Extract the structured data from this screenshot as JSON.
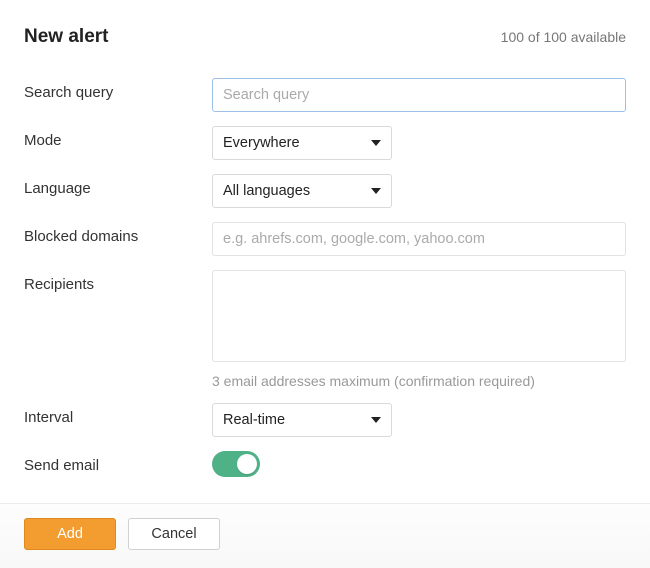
{
  "header": {
    "title": "New alert",
    "available_text": "100 of 100 available"
  },
  "fields": {
    "search_query": {
      "label": "Search query",
      "placeholder": "Search query",
      "value": ""
    },
    "mode": {
      "label": "Mode",
      "selected": "Everywhere"
    },
    "language": {
      "label": "Language",
      "selected": "All languages"
    },
    "blocked_domains": {
      "label": "Blocked domains",
      "placeholder": "e.g. ahrefs.com, google.com, yahoo.com",
      "value": ""
    },
    "recipients": {
      "label": "Recipients",
      "value": "",
      "hint": "3 email addresses maximum (confirmation required)"
    },
    "interval": {
      "label": "Interval",
      "selected": "Real-time"
    },
    "send_email": {
      "label": "Send email",
      "enabled": true
    }
  },
  "footer": {
    "add_label": "Add",
    "cancel_label": "Cancel"
  },
  "colors": {
    "primary_button": "#f39c2f",
    "toggle_on": "#4fb286",
    "focus_border": "#9cc0e6"
  }
}
